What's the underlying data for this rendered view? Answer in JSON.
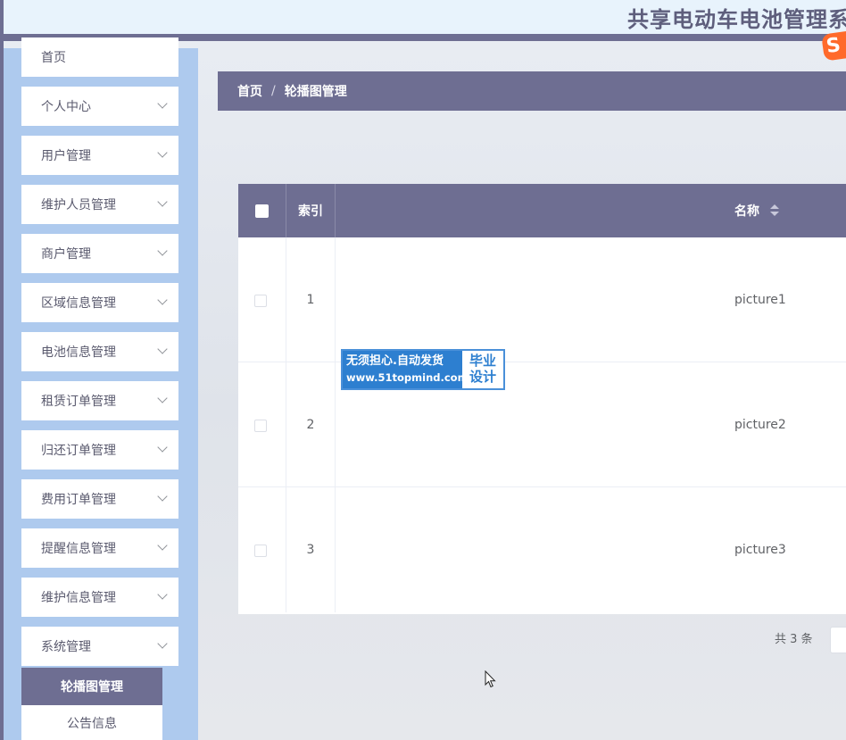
{
  "header": {
    "title": "共享电动车电池管理系统",
    "logo_text": "S"
  },
  "sidebar": {
    "items": [
      {
        "label": "首页"
      },
      {
        "label": "个人中心"
      },
      {
        "label": "用户管理"
      },
      {
        "label": "维护人员管理"
      },
      {
        "label": "商户管理"
      },
      {
        "label": "区域信息管理"
      },
      {
        "label": "电池信息管理"
      },
      {
        "label": "租赁订单管理"
      },
      {
        "label": "归还订单管理"
      },
      {
        "label": "费用订单管理"
      },
      {
        "label": "提醒信息管理"
      },
      {
        "label": "维护信息管理"
      },
      {
        "label": "系统管理"
      }
    ],
    "submenu": {
      "active": "轮播图管理",
      "items": [
        "公告信息"
      ]
    }
  },
  "breadcrumb": {
    "home": "首页",
    "separator": "/",
    "current": "轮播图管理"
  },
  "table": {
    "columns": {
      "index": "索引",
      "name": "名称"
    },
    "rows": [
      {
        "index": "1",
        "name": "picture1"
      },
      {
        "index": "2",
        "name": "picture2"
      },
      {
        "index": "3",
        "name": "picture3"
      }
    ]
  },
  "watermark": {
    "line1": "无须担心.自动发货",
    "line2": "www.51topmind.com",
    "right_top": "毕业",
    "right_bottom": "设计"
  },
  "pagination": {
    "total_text": "共 3 条"
  },
  "colors": {
    "accent": "#6e6e92",
    "sidebar_bg": "#aecaee",
    "header_bg": "#e8f3fc"
  }
}
